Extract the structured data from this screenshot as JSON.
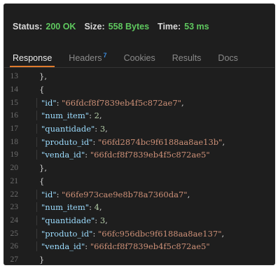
{
  "status_bar": {
    "status_label": "Status:",
    "status_value": "200 OK",
    "size_label": "Size:",
    "size_value": "558 Bytes",
    "time_label": "Time:",
    "time_value": "53 ms"
  },
  "tabs": [
    {
      "label": "Response",
      "active": true
    },
    {
      "label": "Headers",
      "badge": "7"
    },
    {
      "label": "Cookies"
    },
    {
      "label": "Results"
    },
    {
      "label": "Docs"
    }
  ],
  "code_lines": [
    {
      "n": "13",
      "text": "},"
    },
    {
      "n": "14",
      "text": "{"
    },
    {
      "n": "15",
      "key": "\"id\"",
      "sep": ": ",
      "value": "\"66fdcf8f7839eb4f5c872ae7\"",
      "vtype": "str",
      "end": ","
    },
    {
      "n": "16",
      "key": "\"num_item\"",
      "sep": ": ",
      "value": "2",
      "vtype": "num",
      "end": ","
    },
    {
      "n": "17",
      "key": "\"quantidade\"",
      "sep": ": ",
      "value": "3",
      "vtype": "num",
      "end": ","
    },
    {
      "n": "18",
      "key": "\"produto_id\"",
      "sep": ": ",
      "value": "\"66fd2874bc9f6188aa8ae13b\"",
      "vtype": "str",
      "end": ","
    },
    {
      "n": "19",
      "key": "\"venda_id\"",
      "sep": ": ",
      "value": "\"66fdcf8f7839eb4f5c872ae5\"",
      "vtype": "str",
      "end": ""
    },
    {
      "n": "20",
      "text": "},"
    },
    {
      "n": "21",
      "text": "{"
    },
    {
      "n": "22",
      "key": "\"id\"",
      "sep": ": ",
      "value": "\"66fe973cae9e8b78a7360da7\"",
      "vtype": "str",
      "end": ","
    },
    {
      "n": "23",
      "key": "\"num_item\"",
      "sep": ": ",
      "value": "4",
      "vtype": "num",
      "end": ","
    },
    {
      "n": "24",
      "key": "\"quantidade\"",
      "sep": ": ",
      "value": "3",
      "vtype": "num",
      "end": ","
    },
    {
      "n": "25",
      "key": "\"produto_id\"",
      "sep": ": ",
      "value": "\"66fc956dbc9f6188aa8ae137\"",
      "vtype": "str",
      "end": ","
    },
    {
      "n": "26",
      "key": "\"venda_id\"",
      "sep": ": ",
      "value": "\"66fdcf8f7839eb4f5c872ae5\"",
      "vtype": "str",
      "end": ""
    },
    {
      "n": "27",
      "text": "}"
    }
  ],
  "colors": {
    "status_ok": "#5fc95f",
    "active_tab_underline": "#e07b2d",
    "badge": "#3d8ee0",
    "json_key": "#9cdcfe",
    "json_string": "#ce9178",
    "json_number": "#b5cea8"
  }
}
